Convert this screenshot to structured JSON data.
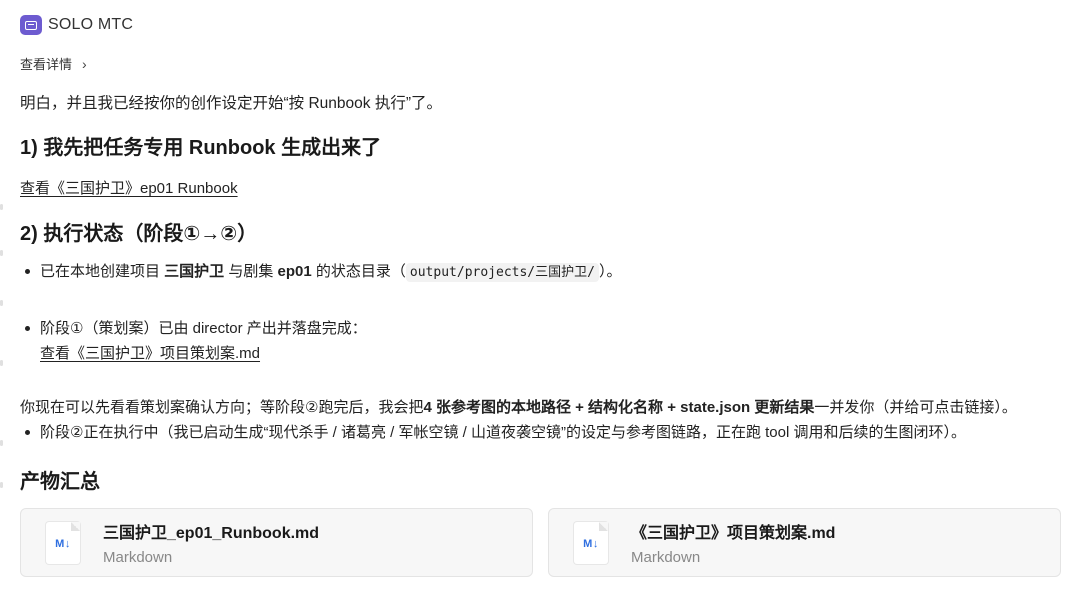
{
  "app": {
    "name": "SOLO MTC",
    "icon": "terminal-icon"
  },
  "details": {
    "label": "查看详情",
    "chevron": "›"
  },
  "intro": "明白，并且我已经按你的创作设定开始“按 Runbook 执行”了。",
  "section1": {
    "title": "1) 我先把任务专用 Runbook 生成出来了",
    "link": "查看《三国护卫》ep01 Runbook"
  },
  "section2": {
    "title": "2) 执行状态（阶段①→②）",
    "bullet1": {
      "pre": "已在本地创建项目 ",
      "project": "三国护卫",
      "mid1": " 与剧集 ",
      "episode": "ep01",
      "mid2": " 的状态目录（",
      "code": "output/projects/三国护卫/",
      "post": "）。"
    },
    "bullet2": {
      "text": "阶段①（策划案）已由 director 产出并落盘完成：",
      "link": "查看《三国护卫》项目策划案.md"
    },
    "bullet3": {
      "text": "阶段②正在执行中（我已启动生成“现代杀手 / 诸葛亮 / 军帐空镜 / 山道夜袭空镜”的设定与参考图链路，正在跑 tool 调用和后续的生图闭环）。"
    }
  },
  "para2": {
    "pre": "你现在可以先看看策划案确认方向；等阶段②跑完后，我会把",
    "bold": "4 张参考图的本地路径 + 结构化名称 + state.json 更新结果",
    "post": "一并发你（并给可点击链接）。"
  },
  "section3": {
    "title": "产物汇总"
  },
  "files": [
    {
      "name": "三国护卫_ep01_Runbook.md",
      "type": "Markdown",
      "icon": "markdown-file-icon",
      "badge": "M↓"
    },
    {
      "name": "《三国护卫》项目策划案.md",
      "type": "Markdown",
      "icon": "markdown-file-icon",
      "badge": "M↓"
    }
  ]
}
